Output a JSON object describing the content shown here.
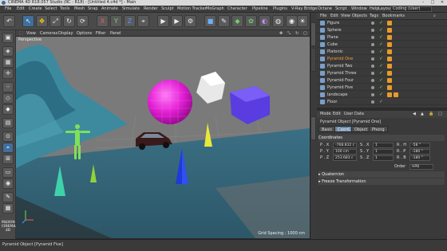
{
  "window": {
    "title": "CINEMA 4D R18.057 Studio (RC - R18) - [Untitled 4.c4d *] - Main",
    "min": "–",
    "max": "□",
    "close": "✕"
  },
  "menu": [
    "File",
    "Edit",
    "Create",
    "Select",
    "Tools",
    "Mesh",
    "Snap",
    "Animate",
    "Simulate",
    "Render",
    "Sculpt",
    "Motion Tracker",
    "MoGraph",
    "Character",
    "Pipeline",
    "Plugins",
    "V-Ray Bridge",
    "Octane",
    "Script",
    "Window",
    "Help"
  ],
  "layout": {
    "label": "Layout:",
    "value": "Coding (User)"
  },
  "toolbar_icons": [
    "undo-icon",
    "pointer-icon",
    "move-icon",
    "scale-icon",
    "rotate-icon",
    "recent-icon",
    "x-axis-icon",
    "y-axis-icon",
    "z-axis-icon",
    "coord-icon",
    "render-view-icon",
    "render-active-icon",
    "render-settings-icon",
    "cube-icon",
    "pen-icon",
    "subdivide-icon",
    "array-icon",
    "deformer-icon",
    "scene-icon",
    "camera-icon",
    "light-icon"
  ],
  "toolbar_glyphs": [
    "↶",
    "↖",
    "✥",
    "⤢",
    "↻",
    "⟳",
    "X",
    "Y",
    "Z",
    "⌖",
    "▶",
    "▶",
    "⚙",
    "■",
    "✎",
    "◆",
    "✿",
    "◐",
    "◍",
    "◉",
    "☀"
  ],
  "left_icons": [
    "make-editable-icon",
    "model-mode-icon",
    "texture-mode-icon",
    "axis-mode-icon",
    "points-mode-icon",
    "edges-mode-icon",
    "polygons-mode-icon",
    "uv-mode-icon",
    "snap-icon",
    "workplane-icon",
    "locked-workplane-icon",
    "planar-icon",
    "solo-icon",
    "paint-icon",
    "grid-icon",
    "display-icon"
  ],
  "viewport": {
    "menu": [
      "View",
      "Cameras",
      "Display",
      "Options",
      "Filter",
      "Panel"
    ],
    "label": "Perspective",
    "grid_spacing": "Grid Spacing : 1000 cm"
  },
  "object_manager": {
    "menu": [
      "File",
      "Edit",
      "View",
      "Objects",
      "Tags",
      "Bookmarks"
    ],
    "objects": [
      {
        "name": "Figure",
        "selected": false
      },
      {
        "name": "Sphere",
        "selected": false
      },
      {
        "name": "Plane",
        "selected": false
      },
      {
        "name": "Cube",
        "selected": false
      },
      {
        "name": "Platonic",
        "selected": false
      },
      {
        "name": "Pyramid One",
        "selected": true
      },
      {
        "name": "Pyramid Two",
        "selected": false
      },
      {
        "name": "Pyramid Three",
        "selected": false
      },
      {
        "name": "Pyramid Four",
        "selected": false
      },
      {
        "name": "Pyramid Five",
        "selected": false
      },
      {
        "name": "landscape",
        "selected": false
      },
      {
        "name": "Floor",
        "selected": false
      }
    ]
  },
  "attributes": {
    "menu": [
      "Mode",
      "Edit",
      "User Data"
    ],
    "title": "Pyramid Object [Pyramid One]",
    "tabs": [
      "Basic",
      "Coord.",
      "Object",
      "Phong"
    ],
    "section_coord": "Coordinates",
    "rows": [
      {
        "p": "P . X",
        "pv": "-768.832 c",
        "s": "S . X",
        "sv": "1",
        "r": "R . H",
        "rv": "-58 °"
      },
      {
        "p": "P . Y",
        "pv": "100 cm",
        "s": "S . Y",
        "sv": "1",
        "r": "R . P",
        "rv": "-180 °"
      },
      {
        "p": "P . Z",
        "pv": "253.683 c",
        "s": "S . Z",
        "sv": "1",
        "r": "R . B",
        "rv": "-180 °"
      }
    ],
    "order_label": "Order",
    "order_value": "HPB",
    "section_quat": "▸ Quaternion",
    "section_freeze": "▸ Freeze Transformation"
  },
  "status": "Pyramid Object [Pyramid Five]",
  "brand": "MAXON CINEMA 4D"
}
